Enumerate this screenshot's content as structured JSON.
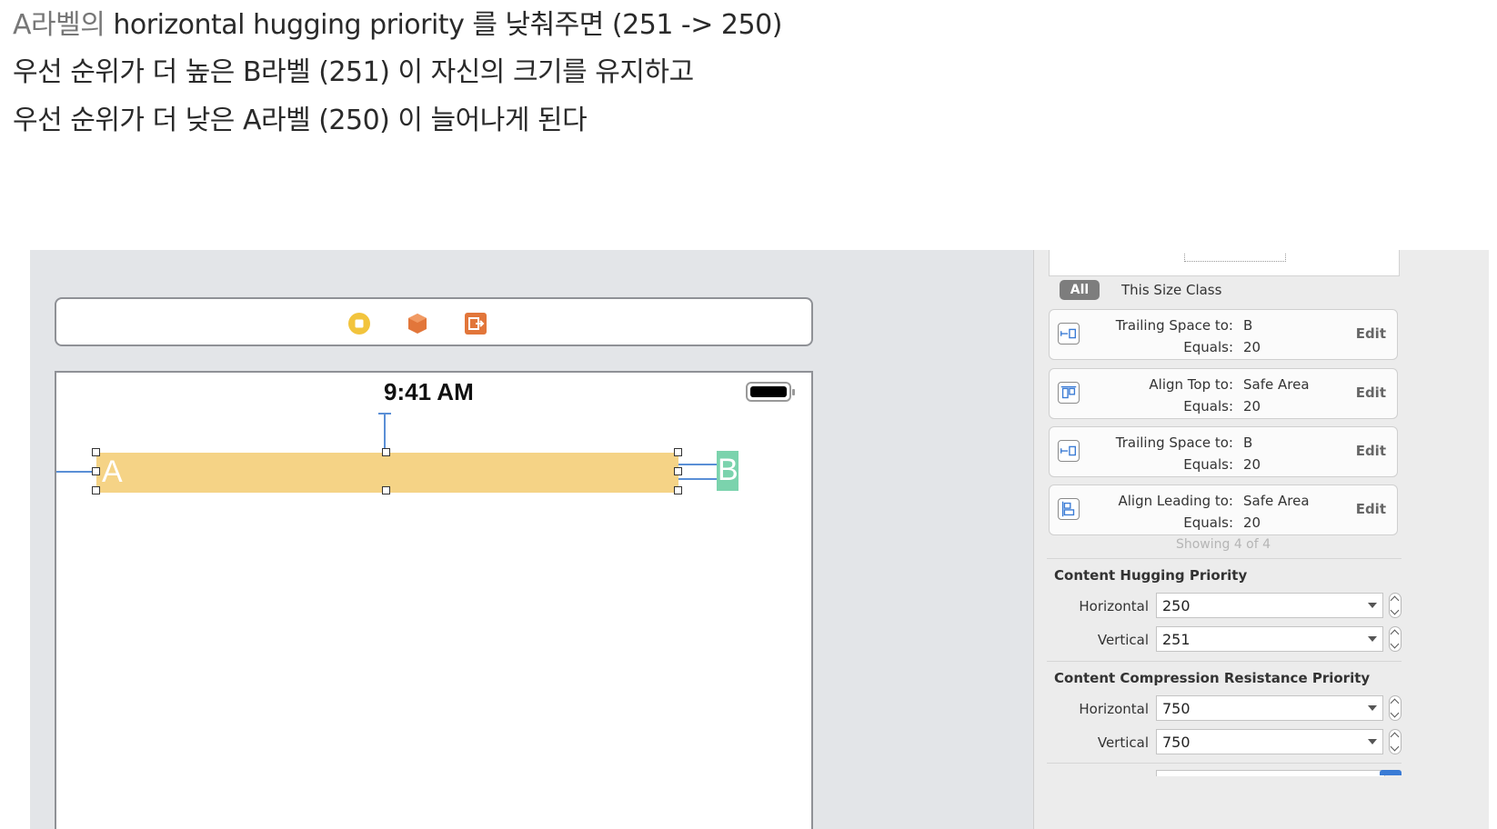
{
  "text": {
    "line1_gray": "A라벨의",
    "line1_rest": " horizontal hugging priority 를 낮춰주면 (251 -> 250)",
    "line2": "우선 순위가 더 높은 B라벨 (251) 이 자신의 크기를 유지하고",
    "line3": "우선 순위가 더 낮은 A라벨 (250) 이 늘어나게 된다"
  },
  "canvas": {
    "scene_icons": [
      "view-controller-icon",
      "first-responder-icon",
      "exit-icon"
    ],
    "status_time": "9:41 AM",
    "label_a": "A",
    "label_b": "B",
    "colors": {
      "label_a_bg": "#f5d386",
      "label_b_bg": "#7bd3ad",
      "constraint": "#5a8fd6"
    }
  },
  "inspector": {
    "size_class": {
      "all": "All",
      "this": "This Size Class"
    },
    "constraints": [
      {
        "icon": "trailing-space-icon",
        "key": "Trailing Space to:",
        "target": "B",
        "equals_label": "Equals:",
        "equals": "20",
        "edit": "Edit"
      },
      {
        "icon": "align-top-icon",
        "key": "Align Top to:",
        "target": "Safe Area",
        "equals_label": "Equals:",
        "equals": "20",
        "edit": "Edit"
      },
      {
        "icon": "trailing-space-icon",
        "key": "Trailing Space to:",
        "target": "B",
        "equals_label": "Equals:",
        "equals": "20",
        "edit": "Edit"
      },
      {
        "icon": "align-leading-icon",
        "key": "Align Leading to:",
        "target": "Safe Area",
        "equals_label": "Equals:",
        "equals": "20",
        "edit": "Edit"
      }
    ],
    "showing": "Showing 4 of 4",
    "hugging": {
      "title": "Content Hugging Priority",
      "h_label": "Horizontal",
      "h_value": "250",
      "v_label": "Vertical",
      "v_value": "251"
    },
    "compression": {
      "title": "Content Compression Resistance Priority",
      "h_label": "Horizontal",
      "h_value": "750",
      "v_label": "Vertical",
      "v_value": "750"
    }
  }
}
